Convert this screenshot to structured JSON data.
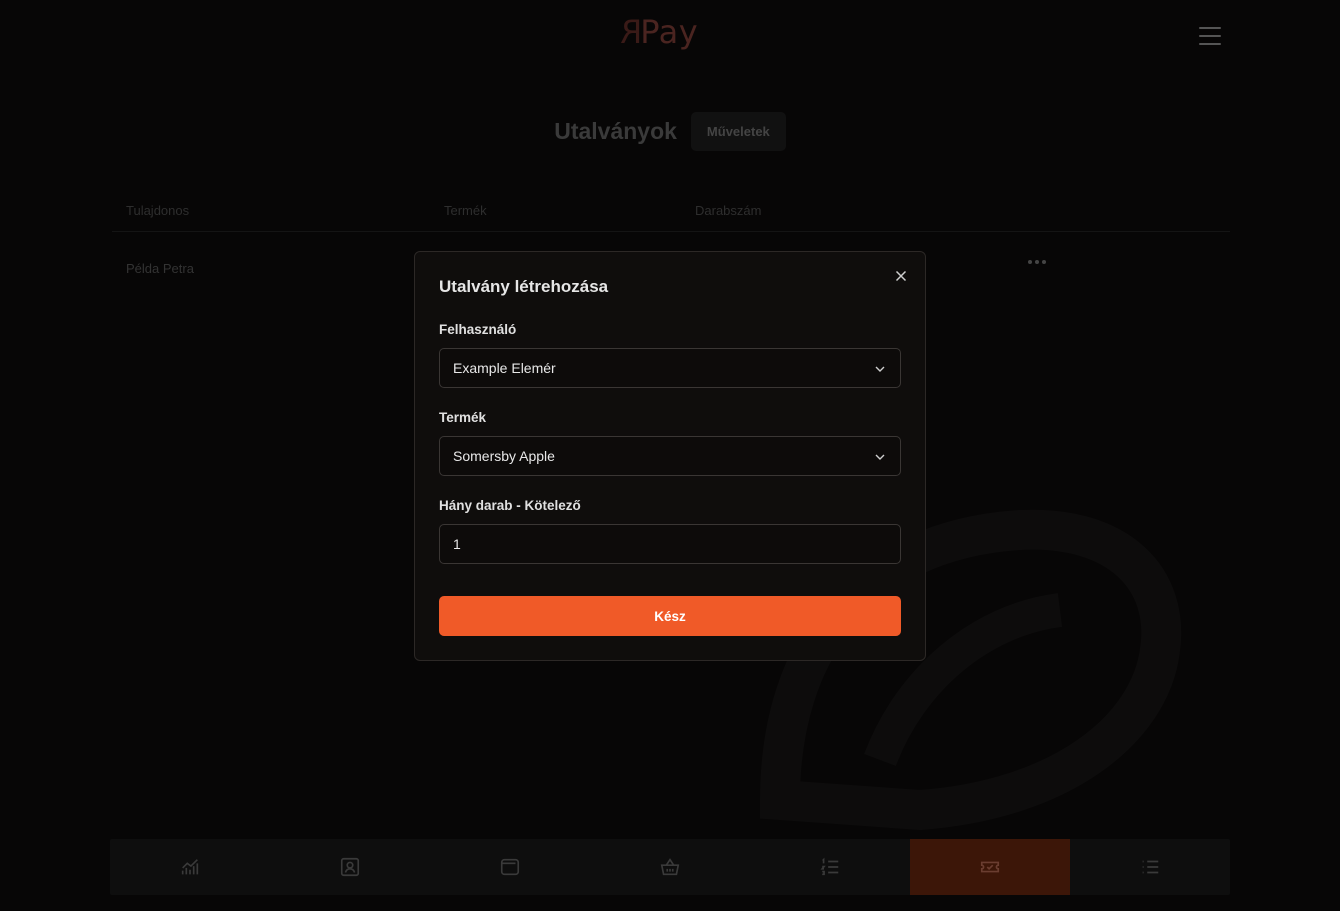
{
  "header": {
    "logo_text": "Pay",
    "logo_mark": "R"
  },
  "page": {
    "title": "Utalványok",
    "actions_label": "Műveletek"
  },
  "table": {
    "columns": [
      "Tulajdonos",
      "Termék",
      "Darabszám"
    ],
    "rows": [
      {
        "owner": "Példa Petra",
        "product": "",
        "count": ""
      }
    ]
  },
  "modal": {
    "title": "Utalvány létrehozása",
    "user_label": "Felhasználó",
    "user_value": "Example Elemér",
    "product_label": "Termék",
    "product_value": "Somersby Apple",
    "quantity_label": "Hány darab - Kötelező",
    "quantity_value": "1",
    "submit_label": "Kész"
  },
  "bottom_nav": {
    "items": [
      {
        "icon": "chart-icon",
        "active": false
      },
      {
        "icon": "user-card-icon",
        "active": false
      },
      {
        "icon": "wallet-icon",
        "active": false
      },
      {
        "icon": "basket-icon",
        "active": false
      },
      {
        "icon": "ordered-list-icon",
        "active": false
      },
      {
        "icon": "ticket-icon",
        "active": true
      },
      {
        "icon": "list-icon",
        "active": false
      }
    ]
  },
  "colors": {
    "accent": "#f05a28",
    "active_nav_bg": "#3c1608",
    "modal_bg": "#0f0d0c"
  }
}
